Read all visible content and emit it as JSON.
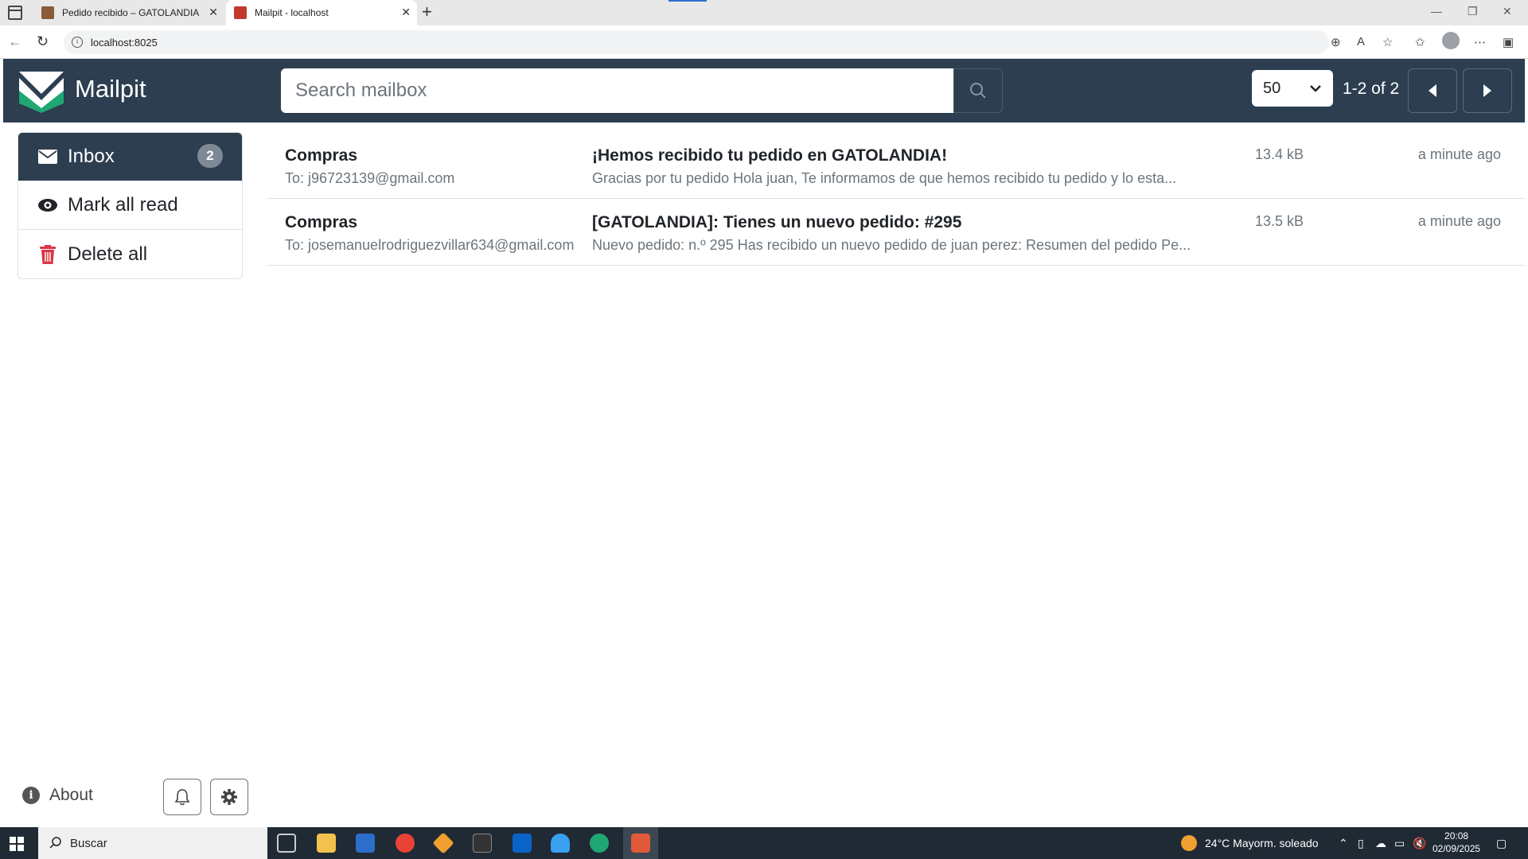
{
  "browser": {
    "tabs": [
      {
        "title": "Pedido recibido – GATOLANDIA",
        "close": "✕"
      },
      {
        "title": "Mailpit - localhost",
        "close": "✕"
      }
    ],
    "new_tab": "+",
    "url": "localhost:8025",
    "window_controls": {
      "minimize": "—",
      "restore": "❐",
      "close": "✕"
    }
  },
  "app": {
    "brand": "Mailpit",
    "search": {
      "placeholder": "Search mailbox"
    },
    "per_page": "50",
    "pagination": "1-2 of 2"
  },
  "sidebar": {
    "items": [
      {
        "label": "Inbox",
        "badge": "2",
        "icon": "envelope-icon"
      },
      {
        "label": "Mark all read",
        "icon": "eye-icon"
      },
      {
        "label": "Delete all",
        "icon": "trash-icon"
      }
    ]
  },
  "messages": [
    {
      "from": "Compras",
      "to": "To: j96723139@gmail.com",
      "subject": "¡Hemos recibido tu pedido en GATOLANDIA!",
      "snippet": "Gracias por tu pedido Hola juan, Te informamos de que hemos recibido tu pedido y lo esta...",
      "size": "13.4 kB",
      "time": "a minute ago"
    },
    {
      "from": "Compras",
      "to": "To: josemanuelrodriguezvillar634@gmail.com",
      "subject": "[GATOLANDIA]: Tienes un nuevo pedido: #295",
      "snippet": "Nuevo pedido: n.º 295 Has recibido un nuevo pedido de juan perez: Resumen del pedido Pe...",
      "size": "13.5 kB",
      "time": "a minute ago"
    }
  ],
  "footer": {
    "about": "About"
  },
  "taskbar": {
    "search": "Buscar",
    "weather": "24°C  Mayorm. soleado",
    "time": "20:08",
    "date": "02/09/2025"
  },
  "colors": {
    "navbar": "#2c3e50",
    "accent": "#2c3e50",
    "trash": "#dc3545",
    "logo_green": "#1fa774"
  }
}
